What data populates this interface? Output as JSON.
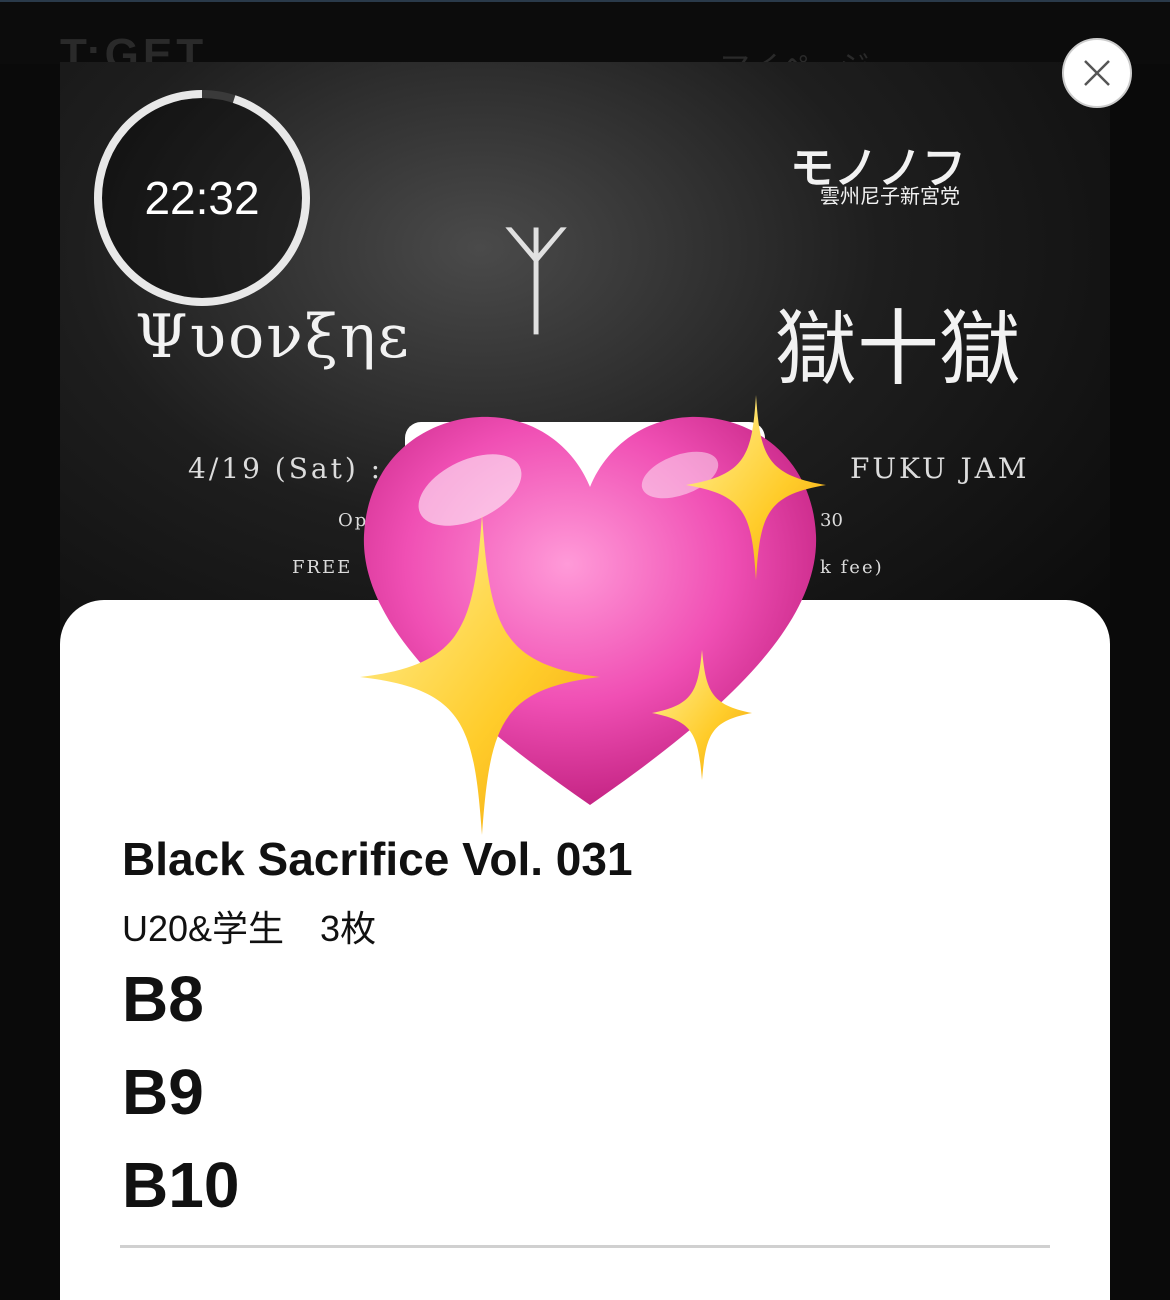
{
  "header": {
    "logo": "T:GET",
    "mypage": "マイページ"
  },
  "flyer": {
    "band1": "Ψυονξηε",
    "band_top_right": "モノノフ",
    "band_top_right_sub": "雲州尼子新宮党",
    "band_center_glyph": "ᛉ",
    "band_right_glyph": "獄十獄",
    "date": "4/19 (Sat) :",
    "venue": "FUKU JAM",
    "open_left": "Op",
    "open_right": "30",
    "free_left": "FREE",
    "free_right": "k fee)"
  },
  "timer": {
    "time": "22:32",
    "progress": 0.95
  },
  "ticket": {
    "event_title": "Black Sacrifice Vol. 031",
    "ticket_type": "U20&学生　3枚",
    "seats": [
      "B8",
      "B9",
      "B10"
    ]
  },
  "colors": {
    "heart": "#f04fb4",
    "sparkle": "#ffcc2a",
    "card": "#ffffff",
    "background": "#0a0a0a"
  },
  "icons": {
    "close": "close-icon",
    "overlay": "sparkling-heart-icon"
  }
}
